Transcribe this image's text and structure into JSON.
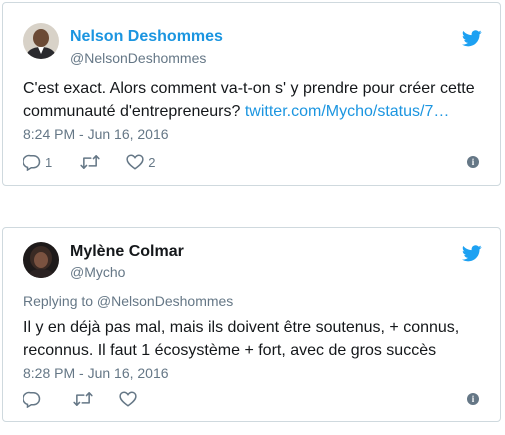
{
  "tweets": [
    {
      "name": "Nelson Deshommes",
      "handle": "@NelsonDeshommes",
      "text": "C'est exact. Alors comment va-t-on s' y prendre pour créer cette communauté d'entrepreneurs? ",
      "link": "twitter.com/Mycho/status/7…",
      "time": "8:24 PM - Jun 16, 2016",
      "reply_count": "1",
      "retweet_count": "",
      "like_count": "2"
    },
    {
      "name": "Mylène Colmar",
      "handle": "@Mycho",
      "replying_to": "Replying to @NelsonDeshommes",
      "text": "Il y en déjà pas mal, mais ils doivent être soutenus, + connus, reconnus. Il faut 1 écosystème + fort, avec de gros succès",
      "time": "8:28 PM - Jun 16, 2016",
      "reply_count": "",
      "retweet_count": "",
      "like_count": ""
    }
  ],
  "colors": {
    "accent": "#1b95e0",
    "muted": "#657786",
    "border": "#cfd9de",
    "text": "#14171a"
  },
  "icons": [
    "twitter-bird-icon",
    "reply-icon",
    "retweet-icon",
    "like-icon",
    "info-icon"
  ]
}
